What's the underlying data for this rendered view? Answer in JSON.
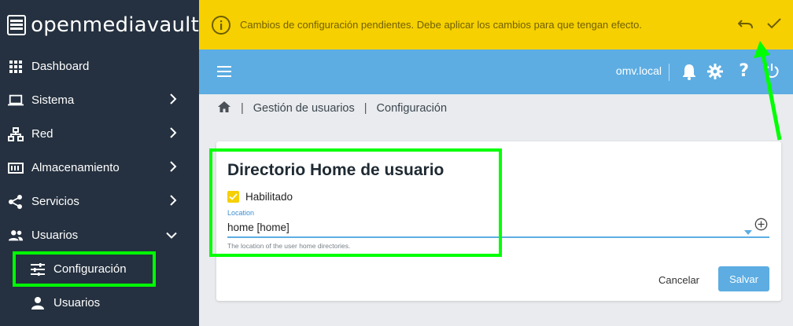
{
  "brand": {
    "name": "openmediavault"
  },
  "sidebar": {
    "items": [
      {
        "label": "Dashboard",
        "icon": "grid-icon",
        "chevron": ""
      },
      {
        "label": "Sistema",
        "icon": "laptop-icon",
        "chevron": "right"
      },
      {
        "label": "Red",
        "icon": "network-icon",
        "chevron": "right"
      },
      {
        "label": "Almacenamiento",
        "icon": "storage-icon",
        "chevron": "right"
      },
      {
        "label": "Servicios",
        "icon": "share-icon",
        "chevron": "right"
      },
      {
        "label": "Usuarios",
        "icon": "users-icon",
        "chevron": "down"
      },
      {
        "label": "Configuración",
        "icon": "tune-icon",
        "chevron": ""
      },
      {
        "label": "Usuarios",
        "icon": "person-icon",
        "chevron": ""
      }
    ]
  },
  "banner": {
    "message": "Cambios de configuración pendientes. Debe aplicar los cambios para que tengan efecto.",
    "icon": "info-icon",
    "undo_icon": "undo-icon",
    "apply_icon": "check-icon"
  },
  "topbar": {
    "host": "omv.local",
    "icons": [
      "menu-icon",
      "bell-icon",
      "gear-icon",
      "help-icon",
      "power-icon"
    ]
  },
  "breadcrumb": {
    "home_icon": "home-icon",
    "items": [
      "Gestión de usuarios",
      "Configuración"
    ]
  },
  "card": {
    "title": "Directorio Home de usuario",
    "checkbox_label": "Habilitado",
    "checkbox_checked": true,
    "field_label": "Location",
    "field_value": "home [home]",
    "field_hint": "The location of the user home directories.",
    "cancel_label": "Cancelar",
    "save_label": "Salvar"
  },
  "colors": {
    "sidebar_bg": "#253140",
    "banner_bg": "#f6d000",
    "topbar_bg": "#5dade2",
    "annotation": "#00ff00"
  }
}
